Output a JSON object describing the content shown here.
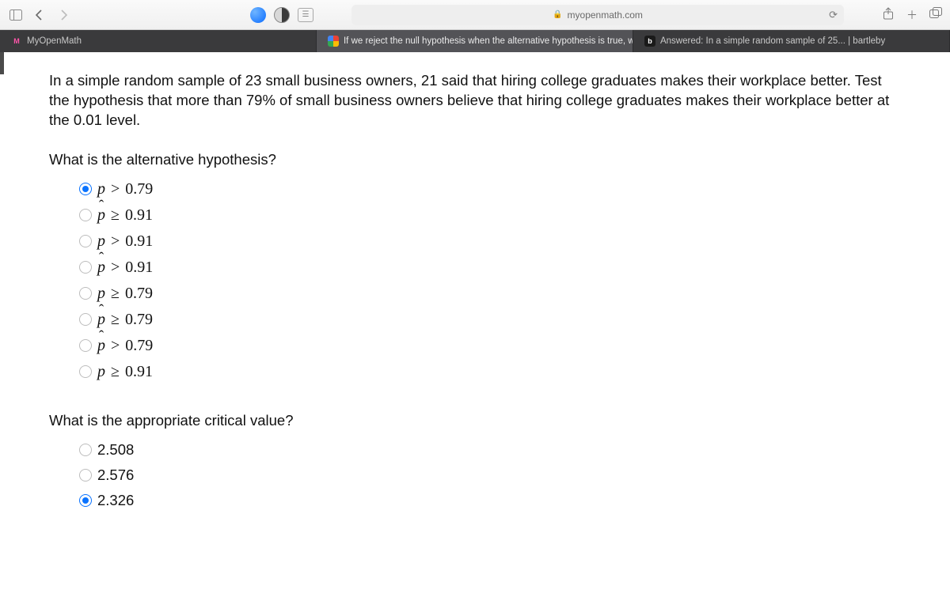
{
  "browser": {
    "url_host": "myopenmath.com",
    "tabs": [
      {
        "label": "MyOpenMath",
        "favicon": "m",
        "active": false
      },
      {
        "label": "If we reject the null hypothesis when the alternative hypothesis is true, we hav...",
        "favicon": "g",
        "active": true
      },
      {
        "label": "Answered: In a simple random sample of 25... | bartleby",
        "favicon": "b",
        "active": false
      }
    ]
  },
  "content": {
    "prompt": "In a simple random sample of 23 small business owners, 21 said that hiring college graduates makes their workplace better. Test the hypothesis that more than 79% of small business owners believe that hiring college graduates makes their workplace better at the 0.01 level.",
    "q1": {
      "text": "What is the alternative hypothesis?",
      "options": [
        {
          "sym": "p",
          "rel": ">",
          "val": "0.79",
          "selected": true
        },
        {
          "sym": "phat",
          "rel": "≥",
          "val": "0.91",
          "selected": false
        },
        {
          "sym": "p",
          "rel": ">",
          "val": "0.91",
          "selected": false
        },
        {
          "sym": "phat",
          "rel": ">",
          "val": "0.91",
          "selected": false
        },
        {
          "sym": "p",
          "rel": "≥",
          "val": "0.79",
          "selected": false
        },
        {
          "sym": "phat",
          "rel": "≥",
          "val": "0.79",
          "selected": false
        },
        {
          "sym": "phat",
          "rel": ">",
          "val": "0.79",
          "selected": false
        },
        {
          "sym": "p",
          "rel": "≥",
          "val": "0.91",
          "selected": false
        }
      ]
    },
    "q2": {
      "text": "What is the appropriate critical value?",
      "options": [
        {
          "label": "2.508",
          "selected": false
        },
        {
          "label": "2.576",
          "selected": false
        },
        {
          "label": "2.326",
          "selected": true
        }
      ]
    }
  }
}
